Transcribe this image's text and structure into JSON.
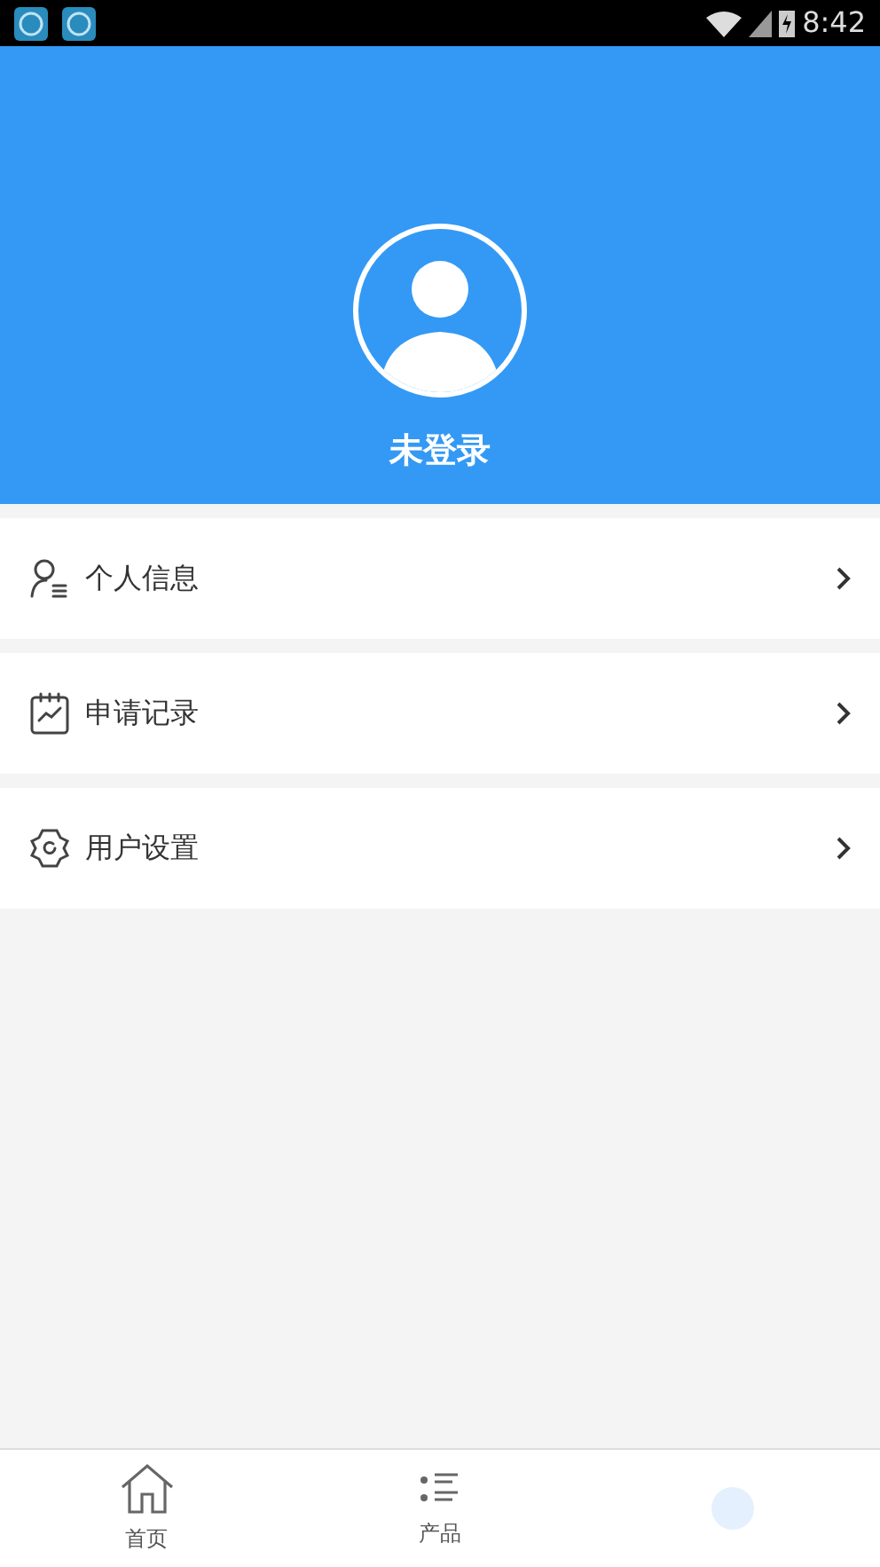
{
  "status_bar": {
    "time": "8:42"
  },
  "profile": {
    "name": "未登录"
  },
  "menu": [
    {
      "label": "个人信息"
    },
    {
      "label": "申请记录"
    },
    {
      "label": "用户设置"
    }
  ],
  "tabs": [
    {
      "label": "首页",
      "selected": false
    },
    {
      "label": "产品",
      "selected": false
    },
    {
      "selected": true
    }
  ]
}
